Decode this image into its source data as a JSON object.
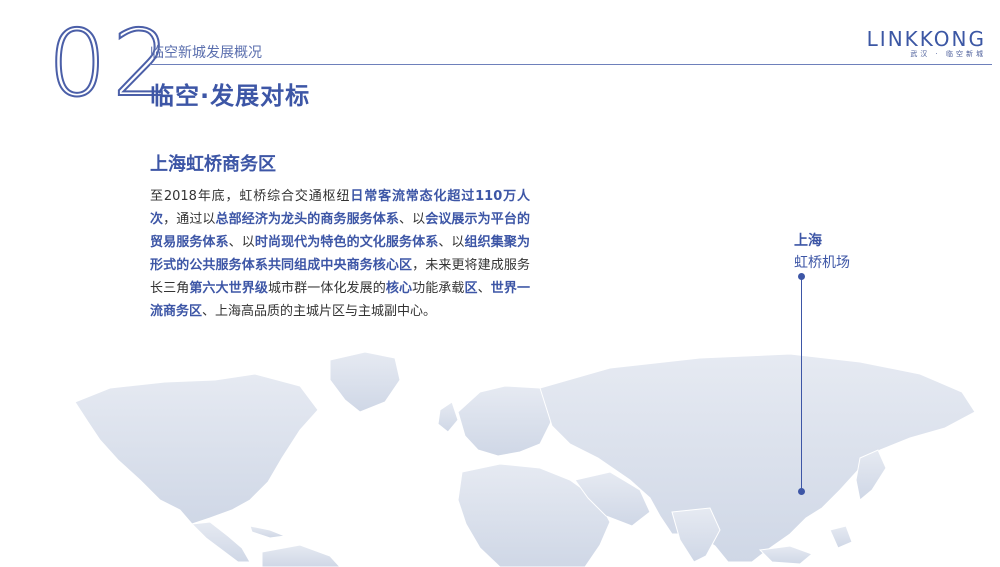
{
  "header": {
    "section_number": "02",
    "subtitle": "临空新城发展概况",
    "title": "临空·发展对标"
  },
  "logo": {
    "wordmark": "LINKKONG",
    "tagline": "武汉 · 临空新城"
  },
  "section": {
    "heading": "上海虹桥商务区",
    "segments": [
      {
        "text": "至2018年底，虹桥综合交通枢纽",
        "hl": false
      },
      {
        "text": "日常客流常态化超过110万人次",
        "hl": true
      },
      {
        "text": "，通过以",
        "hl": false
      },
      {
        "text": "总部经济为龙头的商务服务体系",
        "hl": true
      },
      {
        "text": "、以",
        "hl": false
      },
      {
        "text": "会议展示为平台的贸易服务体系",
        "hl": true
      },
      {
        "text": "、以",
        "hl": false
      },
      {
        "text": "时尚现代为特色的文化服务体系",
        "hl": true
      },
      {
        "text": "、以",
        "hl": false
      },
      {
        "text": "组织集聚为形式的公共服务体系共同组成中央商务核心区",
        "hl": true
      },
      {
        "text": "，未来更将建成服务长三角",
        "hl": false
      },
      {
        "text": "第六大世界级",
        "hl": true
      },
      {
        "text": "城市群一体化发展的",
        "hl": false
      },
      {
        "text": "核心",
        "hl": true
      },
      {
        "text": "功能承载",
        "hl": false
      },
      {
        "text": "区",
        "hl": true
      },
      {
        "text": "、",
        "hl": false
      },
      {
        "text": "世界一流商务区",
        "hl": true
      },
      {
        "text": "、上海高品质的主城片区与主城副中心。",
        "hl": false
      }
    ]
  },
  "marker": {
    "city": "上海",
    "place": "虹桥机场"
  },
  "colors": {
    "accent": "#3d56a6",
    "map_fill": "#d9dfea"
  }
}
